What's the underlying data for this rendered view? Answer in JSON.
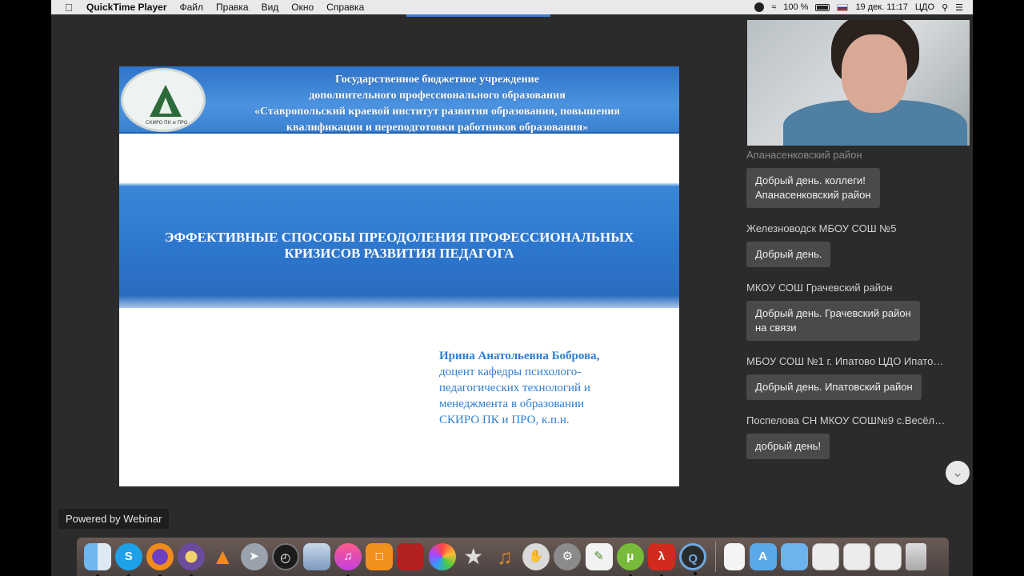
{
  "menubar": {
    "apple": "",
    "app_name": "QuickTime Player",
    "menus": [
      "Файл",
      "Правка",
      "Вид",
      "Окно",
      "Справка"
    ],
    "battery": "100 %",
    "date_time": "19 дек.  11:17",
    "user": "ЦДО"
  },
  "slide": {
    "header_lines": [
      "Государственное бюджетное учреждение",
      "дополнительного  профессионального образования",
      "«Ставропольский краевой  институт развития образования, повышения",
      "квалификации и переподготовки работников образования»"
    ],
    "logo_text": "СКИРО ПК и ПРО",
    "title_lines": [
      "ЭФФЕКТИВНЫЕ СПОСОБЫ ПРЕОДОЛЕНИЯ ПРОФЕССИОНАЛЬНЫХ",
      "КРИЗИСОВ  РАЗВИТИЯ  ПЕДАГОГА"
    ],
    "author_name": "Ирина Анатольевна Боброва,",
    "author_position": "доцент кафедры психолого-\nпедагогических технологий и\nменеджмента в образовании\nСКИРО ПК и ПРО, к.п.н."
  },
  "chat": {
    "messages": [
      {
        "author": "Апанасенковский район",
        "text": "Добрый день. коллеги!\nАпанасенковский район"
      },
      {
        "author": "Железноводск МБОУ СОШ №5",
        "text": "Добрый день."
      },
      {
        "author": "МКОУ СОШ Грачевский район",
        "text": "Добрый день. Грачевский район\nна связи"
      },
      {
        "author": "МБОУ СОШ №1 г. Ипатово ЦДО Ипатов...",
        "text": "Добрый день. Ипатовский район"
      },
      {
        "author": "Поспелова СН МКОУ СОШ№9 с.Весёло...",
        "text": "добрый день!"
      }
    ]
  },
  "powered_by": "Powered by Webinar",
  "dock": {
    "icons": [
      "finder-icon",
      "skype-icon",
      "firefox-icon",
      "tor-icon",
      "vlc-icon",
      "launchpad-icon",
      "dashboard-icon",
      "preview-icon",
      "itunes-icon",
      "ibooks-icon",
      "photo-booth-icon",
      "photos-icon",
      "imovie-icon",
      "garageband-icon",
      "mouse-icon",
      "system-preferences-icon",
      "textedit-icon",
      "utorrent-icon",
      "acrobat-icon",
      "quicktime-icon"
    ],
    "right_icons": [
      "document-icon",
      "applications-folder-icon",
      "folder-icon",
      "screenshot1-icon",
      "screenshot2-icon",
      "screenshot3-icon",
      "trash-icon"
    ]
  }
}
